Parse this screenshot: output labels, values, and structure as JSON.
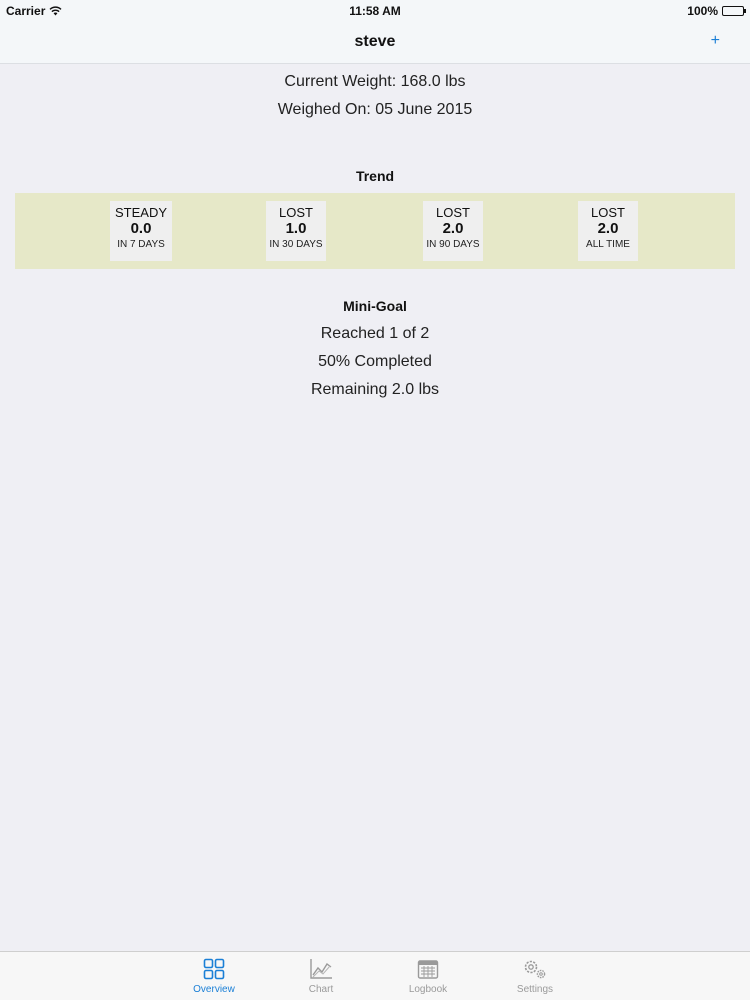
{
  "status_bar": {
    "carrier": "Carrier",
    "time": "11:58 AM",
    "battery": "100%"
  },
  "nav": {
    "title": "steve",
    "add_label": "+"
  },
  "weight": {
    "current": "Current Weight: 168.0 lbs",
    "weighed_on": "Weighed On: 05 June 2015"
  },
  "trend": {
    "title": "Trend",
    "cards": [
      {
        "status": "STEADY",
        "value": "0.0",
        "period": "IN 7 DAYS"
      },
      {
        "status": "LOST",
        "value": "1.0",
        "period": "IN 30 DAYS"
      },
      {
        "status": "LOST",
        "value": "2.0",
        "period": "IN 90 DAYS"
      },
      {
        "status": "LOST",
        "value": "2.0",
        "period": "ALL TIME"
      }
    ]
  },
  "mini_goal": {
    "title": "Mini-Goal",
    "reached": "Reached 1 of 2",
    "completed": "50% Completed",
    "remaining": "Remaining 2.0 lbs"
  },
  "tabs": [
    {
      "label": "Overview",
      "icon": "grid-icon",
      "active": true
    },
    {
      "label": "Chart",
      "icon": "chart-icon",
      "active": false
    },
    {
      "label": "Logbook",
      "icon": "calendar-icon",
      "active": false
    },
    {
      "label": "Settings",
      "icon": "gears-icon",
      "active": false
    }
  ],
  "colors": {
    "accent": "#1a7fd6",
    "trend_band": "#e6e8c8",
    "background": "#efeff4"
  }
}
